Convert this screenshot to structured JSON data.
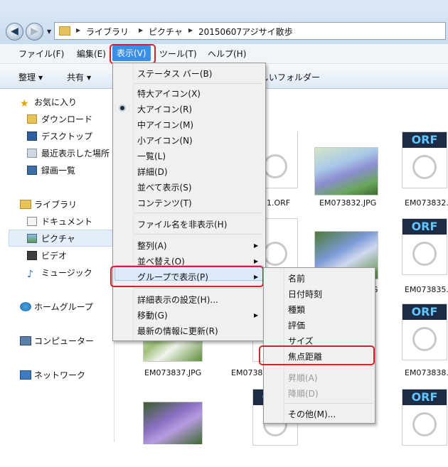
{
  "address": {
    "crumbs": [
      "ライブラリ",
      "ピクチャ",
      "20150607アジサイ散歩"
    ]
  },
  "menubar": {
    "items": [
      "ファイル(F)",
      "編集(E)",
      "表示(V)",
      "ツール(T)",
      "ヘルプ(H)"
    ]
  },
  "toolbar": {
    "organize": "整理",
    "share": "共有",
    "new_folder_partial": "しいフォルダー"
  },
  "nav": {
    "favorites": "お気に入り",
    "downloads": "ダウンロード",
    "desktop": "デスクトップ",
    "recent": "最近表示した場所",
    "recorded_tv": "録画一覧",
    "libraries": "ライブラリ",
    "documents": "ドキュメント",
    "pictures": "ピクチャ",
    "videos": "ビデオ",
    "music": "ミュージック",
    "homegroup": "ホームグループ",
    "computer": "コンピューター",
    "network": "ネットワーク"
  },
  "view_menu": {
    "status_bar": "ステータス バー(B)",
    "xlarge_icons": "特大アイコン(X)",
    "large_icons": "大アイコン(R)",
    "medium_icons": "中アイコン(M)",
    "small_icons": "小アイコン(N)",
    "list": "一覧(L)",
    "details": "詳細(D)",
    "tiles": "並べて表示(S)",
    "content": "コンテンツ(T)",
    "hide_ext": "ファイル名を非表示(H)",
    "sort_by": "整列(A)",
    "sort_order": "並べ替え(O)",
    "group_by": "グループで表示(P)",
    "choose_details": "詳細表示の設定(H)...",
    "go_to": "移動(G)",
    "refresh": "最新の情報に更新(R)"
  },
  "group_submenu": {
    "name": "名前",
    "date": "日付時刻",
    "type": "種類",
    "rating": "評価",
    "size": "サイズ",
    "focal_length": "焦点距離",
    "ascending": "昇順(A)",
    "descending": "降順(D)",
    "more": "その他(M)..."
  },
  "files": {
    "orf_badge": "ORF",
    "f1": "31.ORF",
    "f2": "EM073832.JPG",
    "f3": "EM073832.",
    "f4": "EM073835.",
    "f5": "G",
    "f6": "EM073837.JPG",
    "f7": "EM0738",
    "f8": "EM073838."
  },
  "colors": {
    "accent": "#3a8ee6",
    "highlight_red": "#d5222a"
  }
}
